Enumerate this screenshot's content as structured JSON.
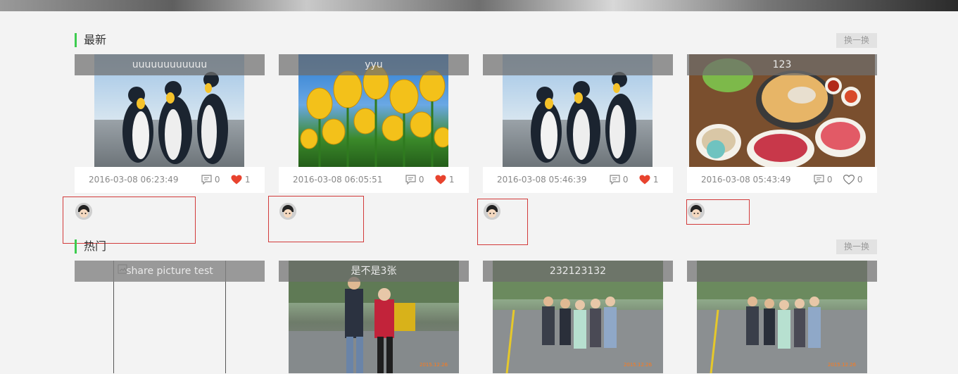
{
  "sections": [
    {
      "title": "最新",
      "swap_label": "换一换"
    },
    {
      "title": "热门",
      "swap_label": "换一换"
    }
  ],
  "latest": [
    {
      "title": "uuuuuuuuuuuu",
      "date": "2016-03-08 06:23:49",
      "comments": "0",
      "likes": "1",
      "liked": true,
      "image": "penguins"
    },
    {
      "title": "yyu",
      "date": "2016-03-08 06:05:51",
      "comments": "0",
      "likes": "1",
      "liked": true,
      "image": "tulips"
    },
    {
      "title": "",
      "date": "2016-03-08 05:46:39",
      "comments": "0",
      "likes": "1",
      "liked": true,
      "image": "penguins"
    },
    {
      "title": "123",
      "date": "2016-03-08 05:43:49",
      "comments": "0",
      "likes": "0",
      "liked": false,
      "image": "hotpot"
    }
  ],
  "hot": [
    {
      "title": "share picture test",
      "image": "broken-image"
    },
    {
      "title": "是不是3张",
      "image": "two-people-street"
    },
    {
      "title": "232123132",
      "image": "group-street"
    },
    {
      "title": "",
      "image": "group-street"
    }
  ],
  "colors": {
    "accent_green": "#3dcc4f",
    "like_red": "#e8432e",
    "highlight_box": "#d23a3a"
  }
}
